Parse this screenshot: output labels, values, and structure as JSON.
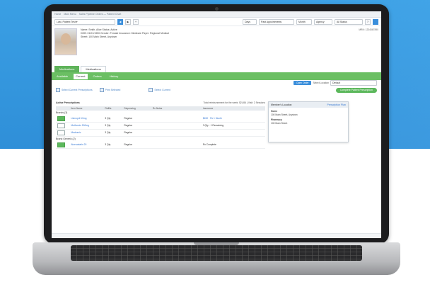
{
  "breadcrumbs": [
    "Home",
    "Main Menu",
    "Sales Pipeline Orders — Patient Chart"
  ],
  "toolbar": {
    "patient_selector": "Last, Patient Test",
    "patient_selector_caret": "▾",
    "filters": [
      "Days",
      "Past Appointments",
      "Month",
      "Agency",
      "All Status"
    ],
    "buttons": [
      "◀",
      "▶",
      "+",
      "?"
    ]
  },
  "patient": {
    "name_line": "Name: Smith, Alice  Status: Active",
    "dob_line": "DOB: 01/01/1950  Gender: Female  Insurance: Medicare  Payer: Regional Medical",
    "address_line": "Street: 100 Main Street, Anytown",
    "id_right": "MRN: 1234567890"
  },
  "tabs": [
    {
      "label": "Medications",
      "active": true
    },
    {
      "label": "Medications",
      "active": false
    }
  ],
  "tab_controls": {
    "button": "Open Order",
    "label": "Select Location",
    "select": "Default"
  },
  "subtabs": [
    {
      "label": "Available",
      "active": false
    },
    {
      "label": "Current",
      "active": true
    },
    {
      "label": "Orders",
      "active": false
    },
    {
      "label": "History",
      "active": false
    }
  ],
  "actions": {
    "a1": "Select Current Prescriptions",
    "a2": "Print Selected",
    "a3": "Select Current",
    "primary": "Complete Patient Prescription"
  },
  "table": {
    "section_title": "Active Prescriptions",
    "summary": "Total reimbursement for the week: $2,654  |  Visit: 2 Sessions",
    "headers": [
      "",
      "Item Name",
      "Refills",
      "Dispensing",
      "Rx Notes",
      "Insurance"
    ],
    "groups": [
      {
        "title": "Brands (3)",
        "rows": [
          {
            "checked": true,
            "name": "Lisinopril 10mg",
            "refills": "3 Qty",
            "disp": "Regular",
            "notes": "",
            "ins": "$450 · Rx 1 Month"
          },
          {
            "checked": false,
            "name": "Metformin 500mg",
            "refills": "3 Qty",
            "disp": "Regular",
            "notes": "",
            "ins": "3 Qty · 1 Remaining"
          },
          {
            "checked": false,
            "name": "Mechanic",
            "refills": "3 Qty",
            "disp": "Regular",
            "notes": "",
            "ins": ""
          }
        ]
      },
      {
        "title": "Brand Generic (2)",
        "rows": [
          {
            "checked": true,
            "name": "Atorvastatin 20",
            "refills": "3 Qty",
            "disp": "Regular",
            "notes": "",
            "ins": "Rx Complete"
          }
        ]
      }
    ]
  },
  "popup": {
    "title": "Member's Location",
    "right": "Prescription Plan",
    "lines": [
      "Home",
      "100 Main Street, Anytown",
      "Pharmacy",
      "100 Main Street"
    ]
  }
}
